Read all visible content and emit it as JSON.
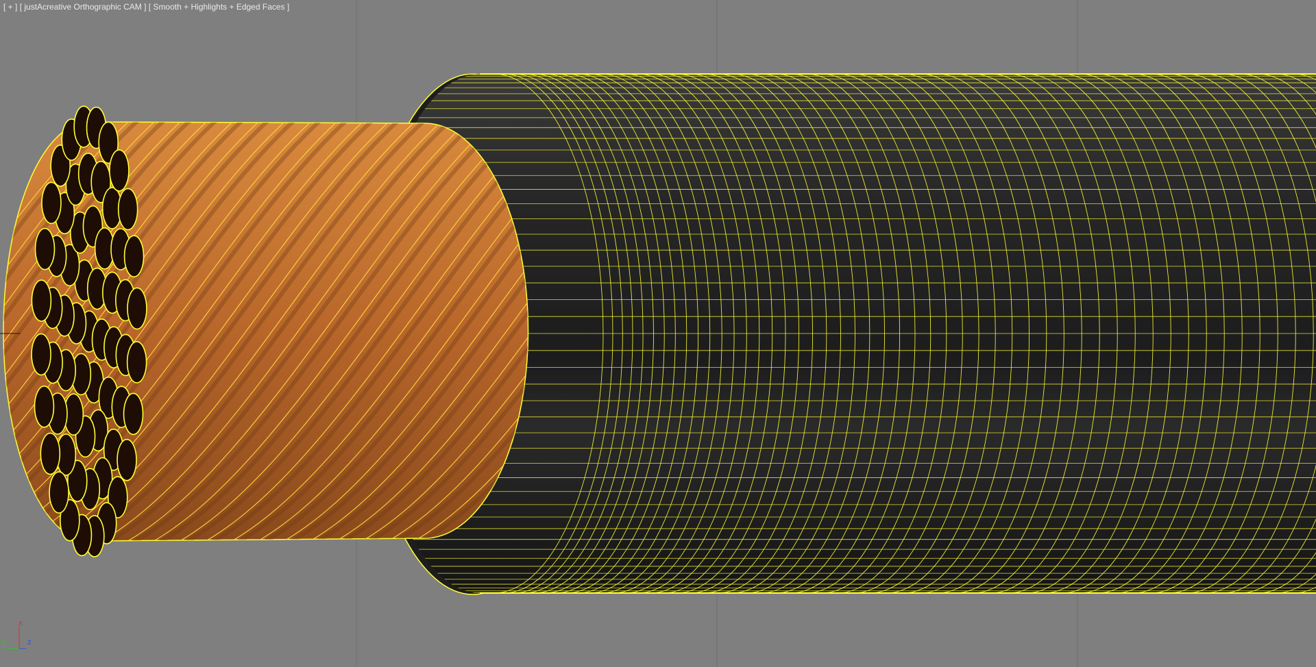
{
  "viewport": {
    "label_plus": "[ + ]",
    "label_camera": "[ justAcreative Orthographic CAM ]",
    "label_shading": "[ Smooth + Highlights + Edged Faces ]",
    "background_color": "#7f7f7f",
    "grid_color": "#6e6e6e",
    "wire_color": "#ffff33",
    "insulation_color": "#232323",
    "copper_color": "#c8772f",
    "strand_end_color": "#1e0d05"
  },
  "axis_gizmo": {
    "x_label": "x",
    "y_label": "y",
    "z_label": "z",
    "x_color": "#e03030",
    "y_color": "#30c030",
    "z_color": "#3050e0"
  },
  "icons": [
    "axis-tripod-icon"
  ]
}
